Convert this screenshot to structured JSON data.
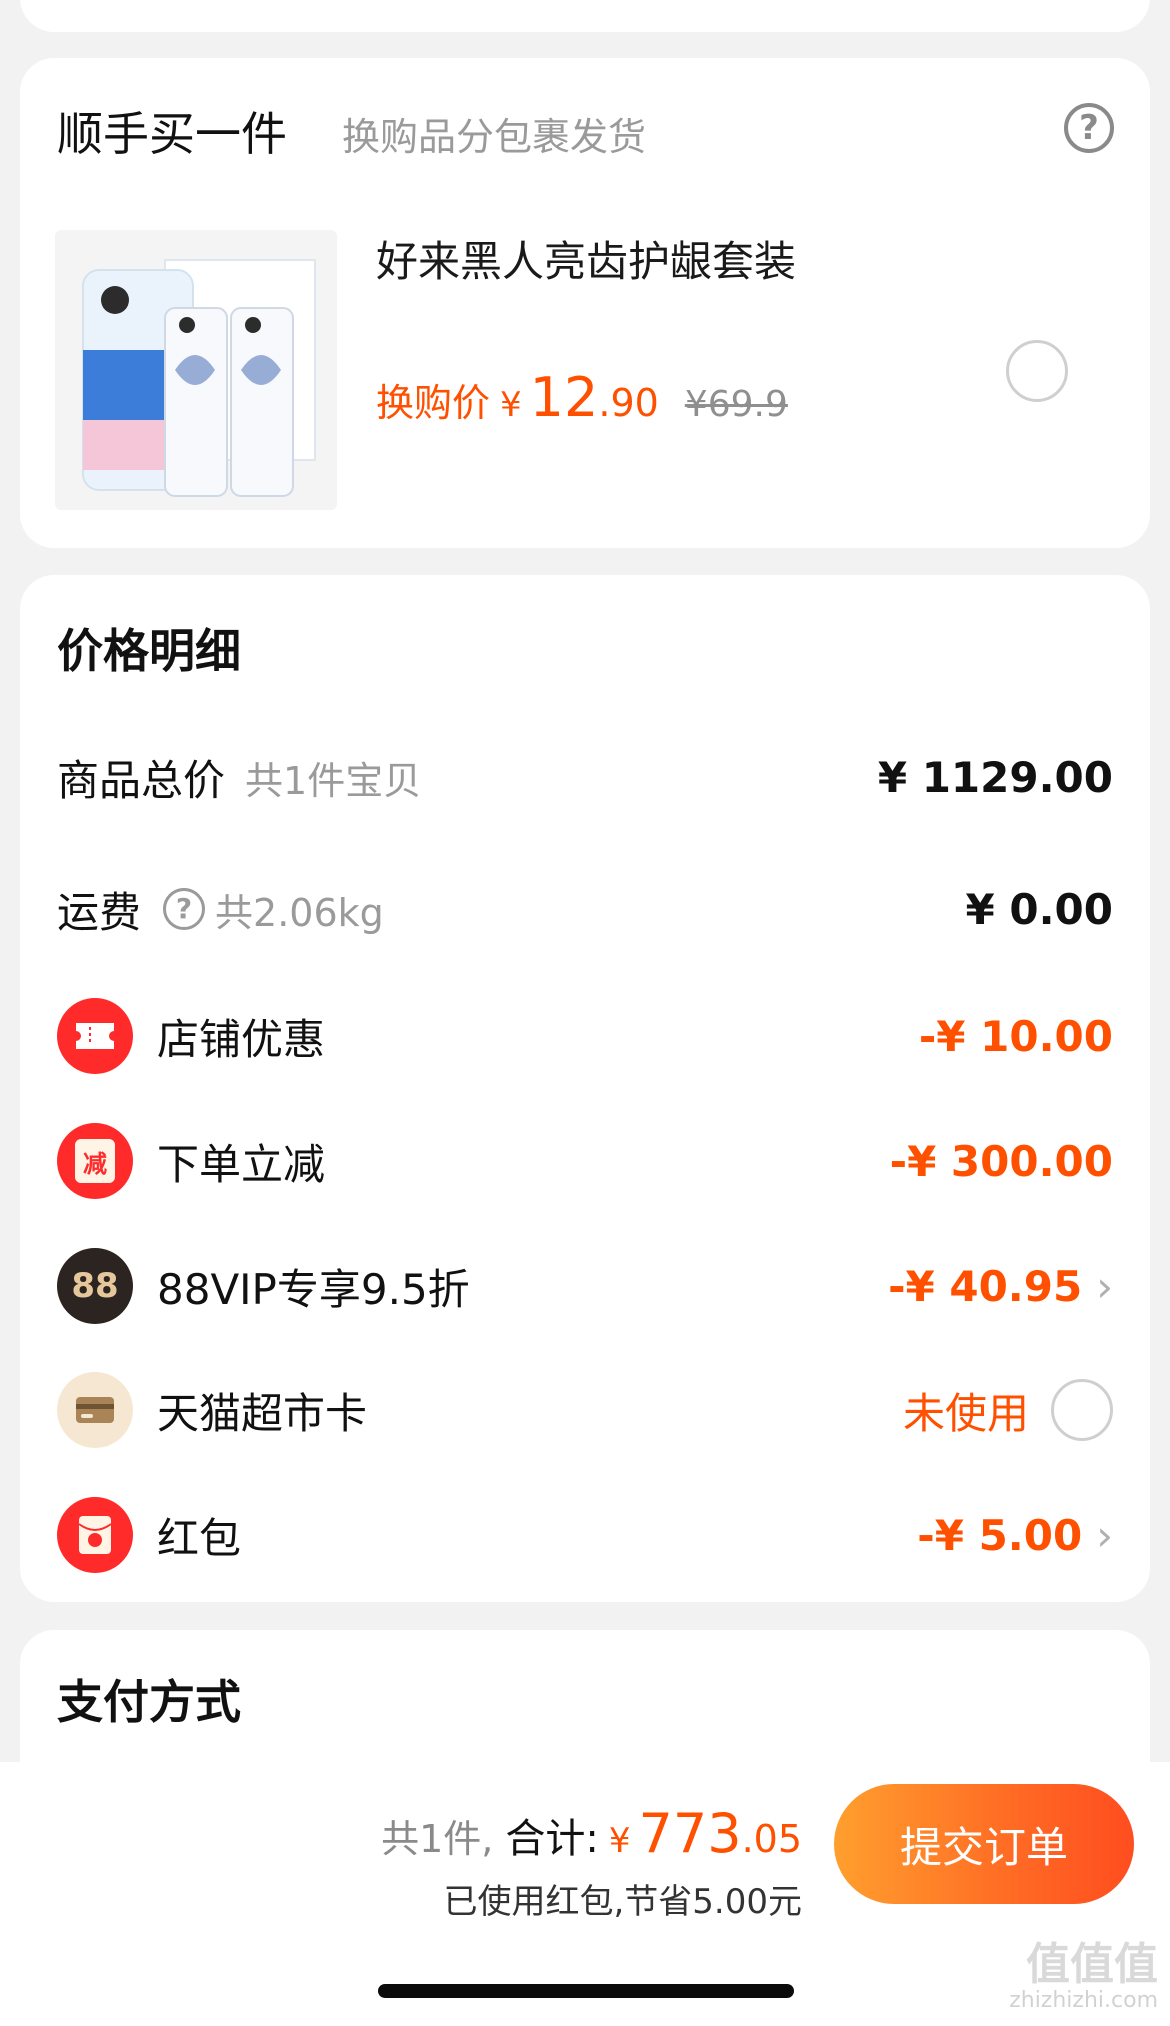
{
  "addon": {
    "title": "顺手买一件",
    "subtitle": "换购品分包裹发货",
    "help_glyph": "?",
    "product": {
      "name": "好来黑人亮齿护龈套装",
      "price_label": "换购价",
      "currency": "¥",
      "price_int": "12",
      "price_dec": ".90",
      "original_price": "¥69.9",
      "selected": false
    }
  },
  "price_detail": {
    "title": "价格明细",
    "subtotal": {
      "label": "商品总价",
      "sub": "共1件宝贝",
      "value": "¥ 1129.00"
    },
    "shipping": {
      "label": "运费",
      "help_glyph": "?",
      "sub": "共2.06kg",
      "value": "¥ 0.00"
    },
    "store_discount": {
      "label": "店铺优惠",
      "value": "-¥ 10.00",
      "icon": "ticket-icon"
    },
    "instant_discount": {
      "label": "下单立减",
      "value": "-¥ 300.00",
      "icon": "reduce-badge-icon",
      "icon_text": "减"
    },
    "vip_discount": {
      "label": "88VIP专享9.5折",
      "value": "-¥ 40.95",
      "icon": "88vip-icon",
      "icon_text": "88",
      "chevron": "›"
    },
    "supermarket_card": {
      "label": "天猫超市卡",
      "status": "未使用",
      "icon": "card-icon",
      "selected": false
    },
    "red_packet": {
      "label": "红包",
      "value": "-¥ 5.00",
      "icon": "red-envelope-icon",
      "chevron": "›"
    }
  },
  "payment": {
    "title": "支付方式"
  },
  "bottom_bar": {
    "count_text": "共1件,",
    "total_label": "合计:",
    "currency": "¥",
    "total_int": "773",
    "total_dec": ".05",
    "saved_text": "已使用红包,节省5.00元",
    "submit_label": "提交订单"
  },
  "watermark": {
    "text": "值值值",
    "sub": "zhizhizhi.com"
  },
  "colors": {
    "accent": "#ff5000",
    "background": "#f2f2f2",
    "card": "#ffffff",
    "muted_text": "#9a9a9a",
    "button_start": "#ff9f2e",
    "button_end": "#ff4d1f",
    "icon_red": "#ff2b2b",
    "icon_dark": "#2b2420"
  }
}
